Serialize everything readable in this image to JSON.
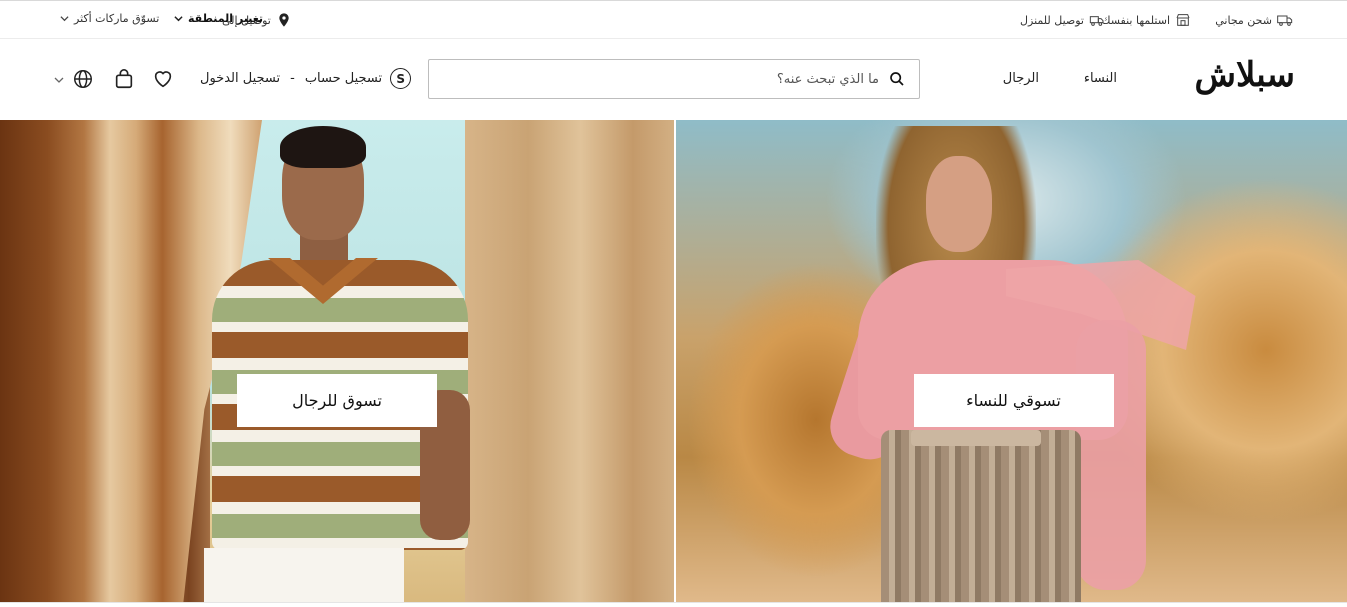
{
  "topbar": {
    "free_shipping": "شحن مجاني",
    "pickup": "استلمها بنفسك",
    "home_delivery": "توصيل للمنزل",
    "deliver_to": "توصيل إلى",
    "change_region": "تغيير المنطقة",
    "shop_brands": "تسوّق ماركات أكثر"
  },
  "header": {
    "logo": "سبلاش",
    "nav": {
      "women": "النساء",
      "men": "الرجال"
    },
    "search_placeholder": "ما الذي تبحث عنه؟",
    "account": {
      "badge": "S",
      "register": "تسجيل حساب",
      "separator": "-",
      "login": "تسجيل الدخول"
    }
  },
  "hero": {
    "men_cta": "تسوق للرجال",
    "women_cta": "تسوقي للنساء"
  },
  "icons": {
    "truck": "truck-icon",
    "store": "store-icon",
    "delivery": "delivery-truck-icon",
    "location": "location-pin-icon",
    "search": "search-icon",
    "heart": "heart-icon",
    "bag": "shopping-bag-icon",
    "globe": "globe-icon",
    "chevron": "chevron-down-icon"
  }
}
